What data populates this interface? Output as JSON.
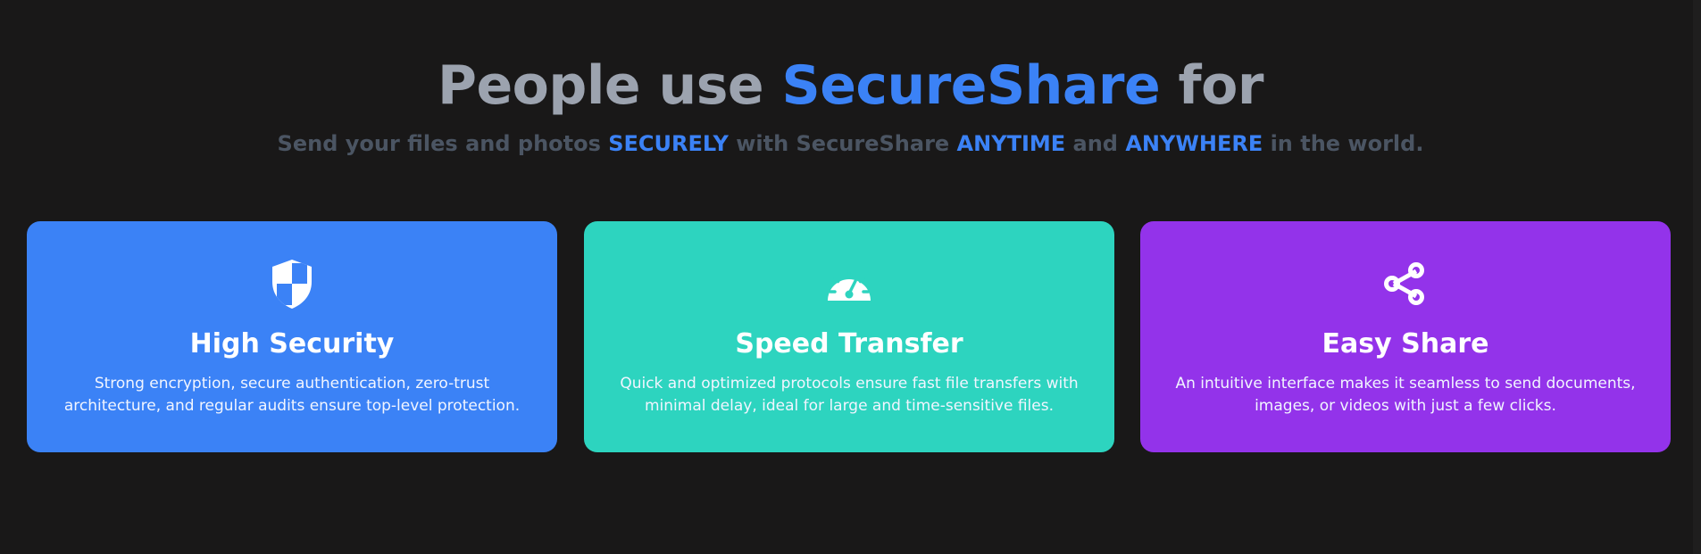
{
  "hero": {
    "title_prefix": "People use ",
    "title_brand": "SecureShare",
    "title_suffix": " for",
    "subtitle_parts": [
      "Send your files and photos ",
      "SECURELY",
      " with SecureShare ",
      "ANYTIME",
      " and ",
      "ANYWHERE",
      " in the world."
    ]
  },
  "features": [
    {
      "icon": "shield-icon",
      "title": "High Security",
      "description": "Strong encryption, secure authentication, zero-trust architecture, and regular audits ensure top-level protection.",
      "color": "#3b82f6"
    },
    {
      "icon": "speedometer-icon",
      "title": "Speed Transfer",
      "description": "Quick and optimized protocols ensure fast file transfers with minimal delay, ideal for large and time-sensitive files.",
      "color": "#2dd4bf"
    },
    {
      "icon": "share-icon",
      "title": "Easy Share",
      "description": "An intuitive interface makes it seamless to send documents, images, or videos with just a few clicks.",
      "color": "#9333ea"
    }
  ],
  "colors": {
    "background": "#191818",
    "accent": "#3b82f6",
    "title_gray": "#9ca3af",
    "subtitle_gray": "#4b5563"
  }
}
